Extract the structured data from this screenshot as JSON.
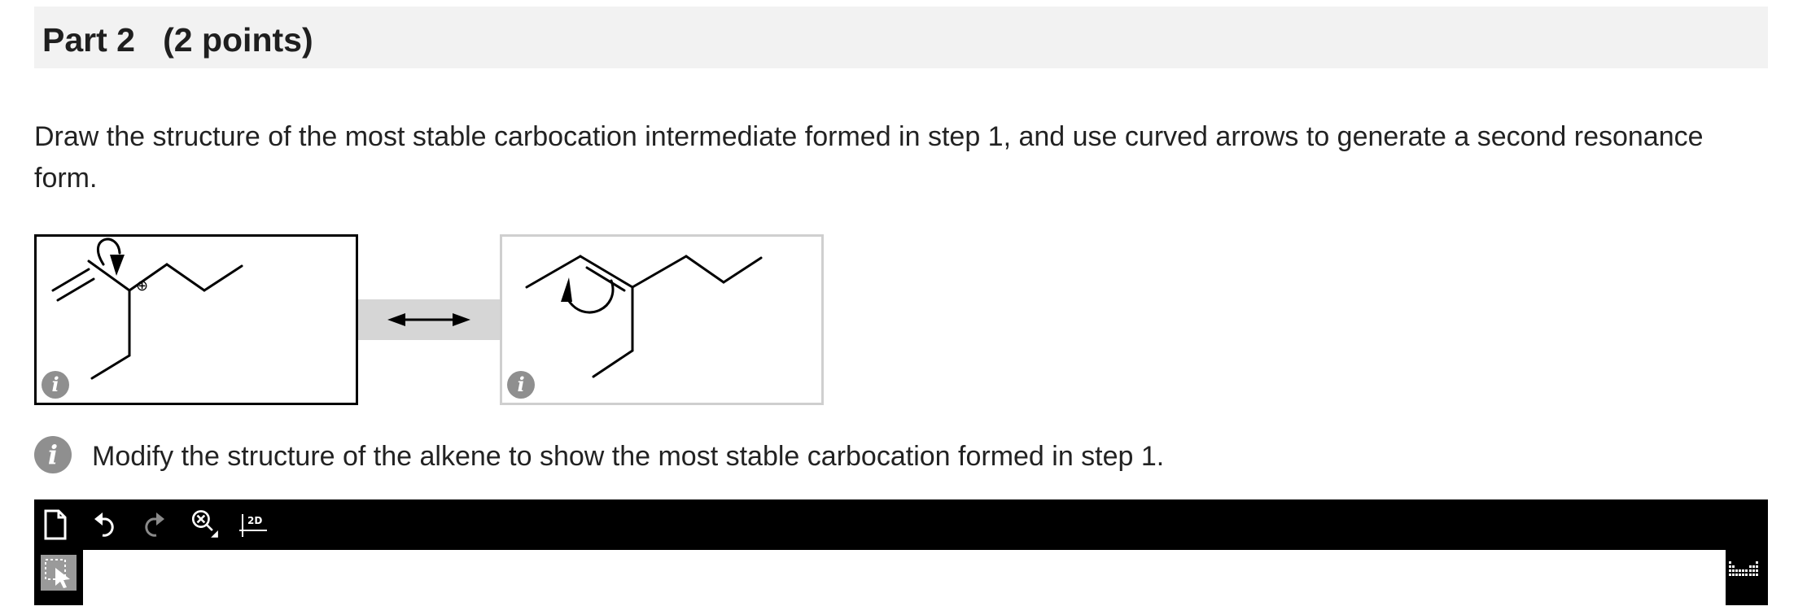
{
  "part": {
    "title": "Part 2   (2 points)"
  },
  "instructions": "Draw the structure of the most stable carbocation intermediate formed in step 1, and use curved arrows to generate a second resonance form.",
  "resonance": {
    "info_symbol": "i",
    "charge_symbol": "⊕"
  },
  "hint": {
    "icon": "i",
    "text": "Modify the structure of the alkene to show the most stable carbocation formed in step 1."
  },
  "editor": {
    "tools": [
      "new-document-icon",
      "undo-icon",
      "redo-icon",
      "zoom-clear-icon",
      "2d-clean-icon"
    ],
    "clean_label": "2D",
    "left_tools": [
      "selection-tool-icon"
    ],
    "right_tools": [
      "periodic-table-icon"
    ]
  }
}
